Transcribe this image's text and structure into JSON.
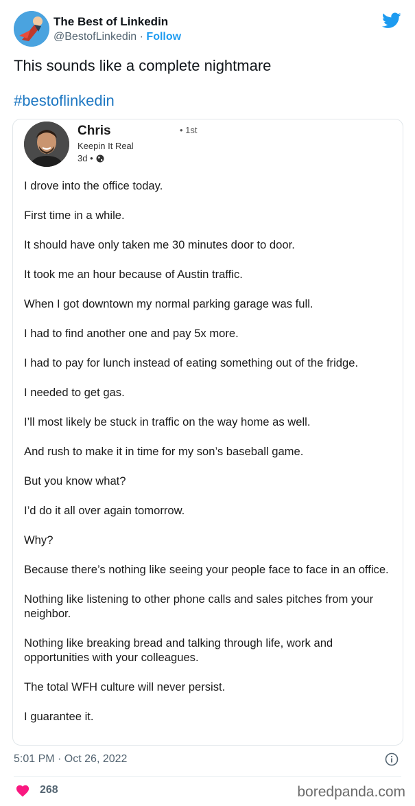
{
  "tweet": {
    "author_name": "The Best of Linkedin",
    "handle": "@BestofLinkedin",
    "separator": " · ",
    "follow_label": "Follow",
    "text": "This sounds like a complete nightmare",
    "hashtag": "#bestoflinkedin",
    "timestamp": "5:01 PM · Oct 26, 2022",
    "like_count": "268",
    "icons": {
      "twitter": "twitter-bird-icon",
      "info": "info-icon",
      "like": "heart-icon"
    },
    "colors": {
      "accent": "#1d9bf0",
      "like": "#f91880"
    }
  },
  "linkedin_post": {
    "name": "Chris",
    "degree": "• 1st",
    "headline": "Keepin It Real",
    "age": "3d •",
    "paragraphs": [
      "I drove into the office today.",
      "First time in a while.",
      "It should have only taken me 30 minutes door to door.",
      "It took me an hour because of Austin traffic.",
      "When I got downtown my normal parking garage was full.",
      "I had to find another one and pay 5x more.",
      "I had to pay for lunch instead of eating something out of the fridge.",
      "I needed to get gas.",
      "I’ll most likely be stuck in traffic on the way home as well.",
      "And rush to make it in time for my son’s baseball game.",
      "But you know what?",
      "I’d do it all over again tomorrow.",
      "Why?",
      "Because there’s nothing like seeing your people face to face in an office.",
      "Nothing like listening to other phone calls and sales pitches from your neighbor.",
      "Nothing like breaking bread and talking through life, work and opportunities with your colleagues.",
      "The total WFH culture will never persist.",
      "I guarantee it."
    ]
  },
  "watermark": "boredpanda.com"
}
